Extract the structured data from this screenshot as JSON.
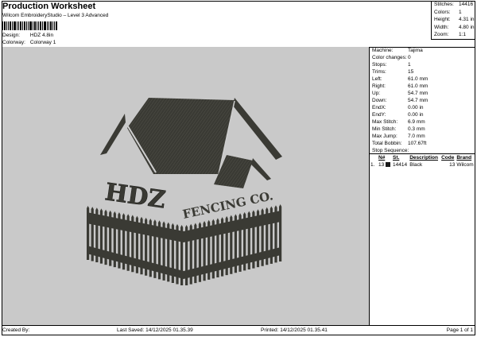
{
  "header": {
    "title": "Production Worksheet",
    "subtitle": "Wilcom EmbroideryStudio – Level 3 Advanced"
  },
  "design_info": [
    {
      "key": "Design:",
      "value": "HDZ 4.8in"
    },
    {
      "key": "Colorway:",
      "value": "Colorway 1"
    }
  ],
  "stats": [
    {
      "key": "Stitches:",
      "value": "14416"
    },
    {
      "key": "Colors:",
      "value": "1"
    },
    {
      "key": "Height:",
      "value": "4.31 in"
    },
    {
      "key": "Width:",
      "value": "4.80 in"
    },
    {
      "key": "Zoom:",
      "value": "1:1"
    }
  ],
  "machine_info": [
    {
      "key": "Machine:",
      "value": "Tajima"
    },
    {
      "key": "Color changes:",
      "value": "0"
    },
    {
      "key": "Stops:",
      "value": "1"
    },
    {
      "key": "Trims:",
      "value": "15"
    },
    {
      "key": "Left:",
      "value": "61.0 mm"
    },
    {
      "key": "Right:",
      "value": "61.0 mm"
    },
    {
      "key": "Up:",
      "value": "54.7 mm"
    },
    {
      "key": "Down:",
      "value": "54.7 mm"
    },
    {
      "key": "EndX:",
      "value": "0.00 in"
    },
    {
      "key": "EndY:",
      "value": "0.00 in"
    },
    {
      "key": "Max Stitch:",
      "value": "6.9 mm"
    },
    {
      "key": "Min Stitch:",
      "value": "0.3 mm"
    },
    {
      "key": "Max Jump:",
      "value": "7.0 mm"
    },
    {
      "key": "Total Bobbin:",
      "value": "107.67ft"
    }
  ],
  "stop_sequence": {
    "label": "Stop Sequence:",
    "columns": [
      "N#",
      "St.",
      "Description",
      "Code",
      "Brand"
    ],
    "rows": [
      {
        "index": "1.",
        "n": "13",
        "st": "14414",
        "description": "Black",
        "code": "13",
        "brand": "Wilcom",
        "color": "#1a1a1a"
      }
    ]
  },
  "artwork": {
    "text_main": "HDZ",
    "text_secondary": "FENCING CO.",
    "background": "#c9c9c9",
    "thread_color": "#3a3a34"
  },
  "footer": {
    "created_by": "Created By:",
    "last_saved": "Last Saved: 14/12/2025 01.35.39",
    "printed": "Printed: 14/12/2025 01.35.41",
    "page": "Page 1 of 1"
  }
}
